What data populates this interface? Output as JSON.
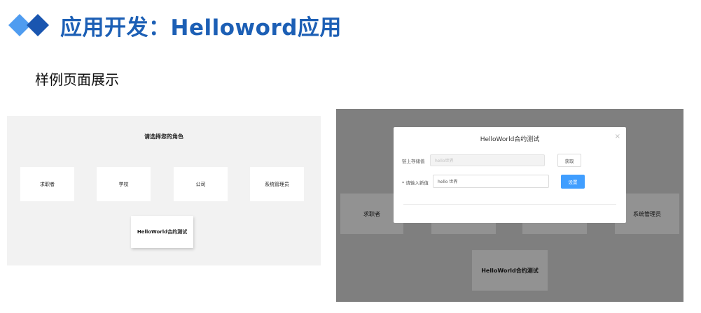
{
  "slide": {
    "title": "应用开发：Helloword应用",
    "subtitle": "样例页面展示",
    "logo_colors": [
      "#4f9cf0",
      "#1a56b0"
    ],
    "title_color": "#1c5fb5"
  },
  "left_screen": {
    "heading": "请选择您的角色",
    "roles": [
      "求职者",
      "学校",
      "公司",
      "系统管理员"
    ],
    "test_card": "HelloWorld合约测试"
  },
  "right_screen": {
    "background_cards": {
      "seeker": "求职者",
      "admin": "系统管理员",
      "test": "HelloWorld合约测试"
    },
    "modal": {
      "title": "HelloWorld合约测试",
      "close_icon": "×",
      "address_label": "链上存储值",
      "address_placeholder": "hello世界",
      "get_button": "获取",
      "value_label": "* 请输入新值",
      "value_input": "hello 世界",
      "set_button": "设置"
    },
    "accent_color": "#409eff"
  }
}
